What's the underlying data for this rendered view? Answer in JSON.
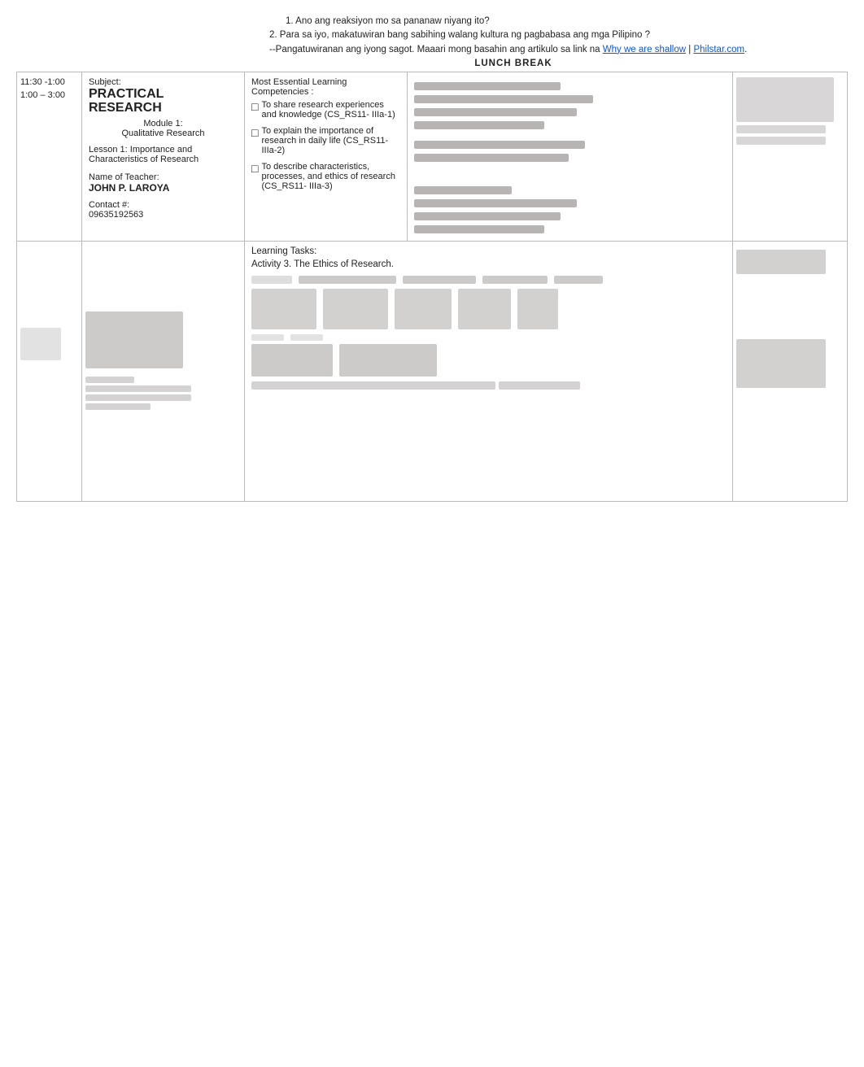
{
  "header": {
    "question1": "1.   Ano ang reaksiyon mo sa pananaw niyang ito?",
    "question2": "2. Para sa iyo, makatuwiran bang sabihing walang kultura ng pagbabasa ang mga Pilipino ?",
    "pangatuwiran": "--Pangatuwiranan ang iyong sagot. Maaari mong basahin ang artikulo sa link na ",
    "link_text": "Why we are shallow",
    "link_separator": " | ",
    "link_site": "Philstar.com",
    "link_end": ".",
    "lunch_break": "LUNCH BREAK"
  },
  "schedule": {
    "time1": "11:30 -1:00",
    "time2": "1:00 – 3:00",
    "subject_label": "Subject:",
    "subject_title_line1": "PRACTICAL",
    "subject_title_line2": "RESEARCH",
    "module_label": "Module 1:",
    "module_desc": "Qualitative Research",
    "lesson_label": "Lesson 1: Importance and Characteristics of Research",
    "teacher_label": "Name of Teacher:",
    "teacher_name": "JOHN P. LAROYA",
    "contact_label": "Contact #:",
    "contact_number": "09635192563"
  },
  "melc": {
    "title": "Most Essential Learning Competencies :",
    "items": [
      {
        "text": "To share research experiences and knowledge (CS_RS11- IIIa-1)"
      },
      {
        "text": "To explain the importance of research in daily life (CS_RS11- IIIa-2)"
      },
      {
        "text": "To describe characteristics, processes, and ethics of research (CS_RS11- IIIa-3)"
      }
    ]
  },
  "learning_tasks": {
    "title": "Learning Tasks:",
    "activity": "Activity 3. The Ethics of Research."
  }
}
